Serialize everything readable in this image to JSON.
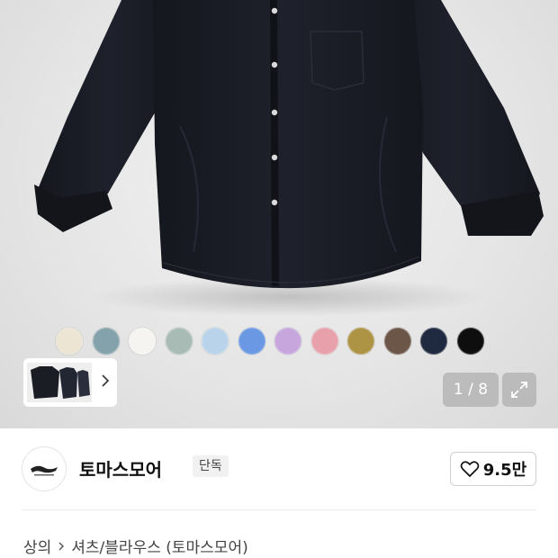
{
  "gallery": {
    "counter": "1 / 8",
    "swatches": [
      {
        "name": "cream",
        "color": "#ECE5D3"
      },
      {
        "name": "slate-blue",
        "color": "#84A2AB"
      },
      {
        "name": "white",
        "color": "#F5F4F0"
      },
      {
        "name": "sage",
        "color": "#A9BBB5"
      },
      {
        "name": "light-blue",
        "color": "#B8D3EA"
      },
      {
        "name": "blue",
        "color": "#6A98E2"
      },
      {
        "name": "lavender",
        "color": "#C6A6DD"
      },
      {
        "name": "pink",
        "color": "#E8A1AA"
      },
      {
        "name": "olive",
        "color": "#AD9344"
      },
      {
        "name": "brown",
        "color": "#6C5648"
      },
      {
        "name": "navy",
        "color": "#1F2940"
      },
      {
        "name": "black",
        "color": "#0E0E0E"
      }
    ],
    "shirt_color": "#1b1d25"
  },
  "brand": {
    "name": "토마스모어",
    "badge": "단독",
    "likes": "9.5만"
  },
  "breadcrumb": {
    "level1": "상의",
    "level2": "셔츠/블라우스 (토마스모어)"
  }
}
